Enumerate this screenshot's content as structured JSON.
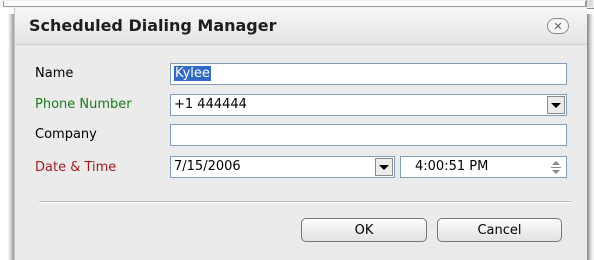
{
  "dialog": {
    "title": "Scheduled Dialing Manager",
    "close_icon": "close-icon",
    "fields": {
      "name": {
        "label": "Name",
        "value": "Kylee",
        "label_color": "#000000"
      },
      "phone": {
        "label": "Phone Number",
        "value": "+1 444444",
        "label_color": "#1a7a1a"
      },
      "company": {
        "label": "Company",
        "value": "",
        "label_color": "#000000"
      },
      "datetime": {
        "label": "Date & Time",
        "date": "7/15/2006",
        "time": "4:00:51 PM",
        "label_color": "#9b1c1c"
      }
    },
    "buttons": {
      "ok": "OK",
      "cancel": "Cancel"
    }
  }
}
